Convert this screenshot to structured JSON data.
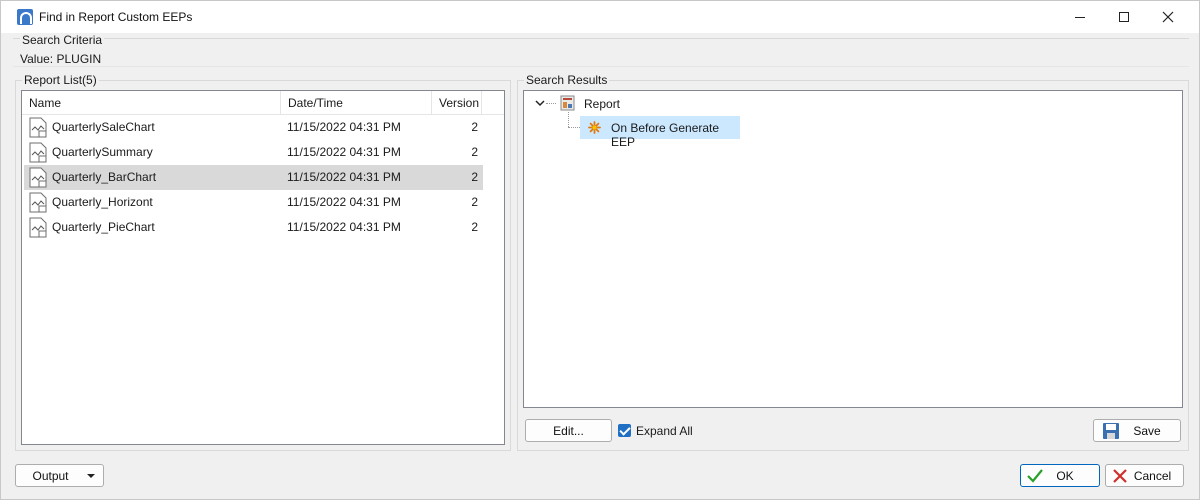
{
  "window": {
    "title": "Find in Report Custom EEPs"
  },
  "search_criteria": {
    "legend": "Search Criteria",
    "value_text": "Value: PLUGIN"
  },
  "report_list": {
    "legend": "Report List(5)",
    "columns": [
      "Name",
      "Date/Time",
      "Version"
    ],
    "rows": [
      {
        "name": "QuarterlySaleChart",
        "datetime": "11/15/2022 04:31 PM",
        "version": "2",
        "selected": false
      },
      {
        "name": "QuarterlySummary",
        "datetime": "11/15/2022 04:31 PM",
        "version": "2",
        "selected": false
      },
      {
        "name": "Quarterly_BarChart",
        "datetime": "11/15/2022 04:31 PM",
        "version": "2",
        "selected": true
      },
      {
        "name": "Quarterly_Horizont",
        "datetime": "11/15/2022 04:31 PM",
        "version": "2",
        "selected": false
      },
      {
        "name": "Quarterly_PieChart",
        "datetime": "11/15/2022 04:31 PM",
        "version": "2",
        "selected": false
      }
    ]
  },
  "search_results": {
    "legend": "Search Results",
    "tree": {
      "root_label": "Report",
      "root_expanded": true,
      "child_label": "On Before Generate EEP",
      "child_selected": true
    },
    "edit_button": "Edit...",
    "expand_all_label": "Expand All",
    "expand_all_checked": true,
    "save_button": "Save"
  },
  "footer": {
    "output_button": "Output",
    "ok_button": "OK",
    "cancel_button": "Cancel"
  },
  "colors": {
    "selection_gray": "#d9d9d9",
    "selection_blue": "#cce8ff",
    "accent": "#1f6fc5"
  }
}
